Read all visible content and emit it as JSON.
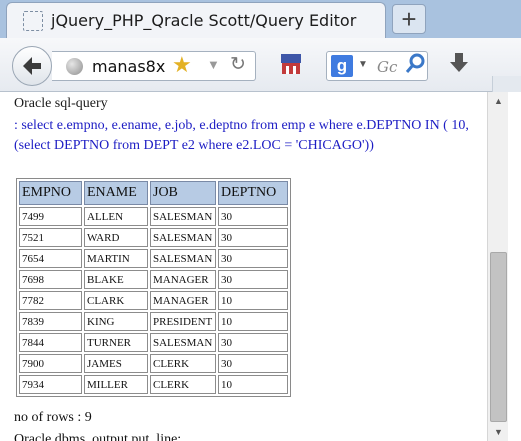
{
  "browser": {
    "tab_title": "jQuery_PHP_Qracle Scott/Query Editor",
    "new_tab_label": "+",
    "url_text": "manas8x",
    "search_engine_label": "g",
    "search_placeholder": "Gc",
    "icons": {
      "back": "back-arrow-icon",
      "site": "globe-icon",
      "bookmark_star": "star-icon",
      "reload": "reload-icon",
      "bookmarks": "bookmark-toolbar-icon",
      "search_engine": "google-icon",
      "search": "search-icon",
      "download": "download-icon"
    }
  },
  "page": {
    "heading": "Oracle sql-query",
    "query_text": ": select e.empno, e.ename, e.job, e.deptno from emp e where e.DEPTNO IN ( 10,(select DEPTNO from DEPT e2 where e2.LOC = 'CHICAGO'))",
    "row_count_text": "no of rows : 9",
    "next_line_text": "Oracle dbms_output.put_line:"
  },
  "results": {
    "columns": [
      "EMPNO",
      "ENAME",
      "JOB",
      "DEPTNO"
    ],
    "rows": [
      [
        "7499",
        "ALLEN",
        "SALESMAN",
        "30"
      ],
      [
        "7521",
        "WARD",
        "SALESMAN",
        "30"
      ],
      [
        "7654",
        "MARTIN",
        "SALESMAN",
        "30"
      ],
      [
        "7698",
        "BLAKE",
        "MANAGER",
        "30"
      ],
      [
        "7782",
        "CLARK",
        "MANAGER",
        "10"
      ],
      [
        "7839",
        "KING",
        "PRESIDENT",
        "10"
      ],
      [
        "7844",
        "TURNER",
        "SALESMAN",
        "30"
      ],
      [
        "7900",
        "JAMES",
        "CLERK",
        "30"
      ],
      [
        "7934",
        "MILLER",
        "CLERK",
        "10"
      ]
    ]
  },
  "colors": {
    "query_text": "#1d1dc4",
    "header_bg": "#b7cbe4",
    "tabstrip_bg": "#a9c2df"
  }
}
